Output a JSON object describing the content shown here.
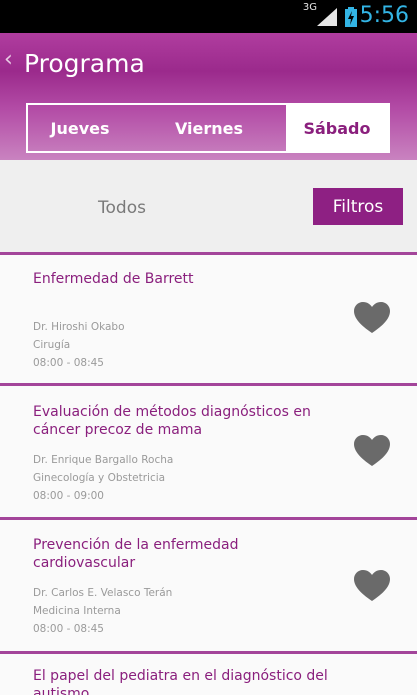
{
  "status_bar": {
    "network": "3G",
    "time": "5:56"
  },
  "header": {
    "title": "Programa",
    "back_icon": "chevron-left-icon"
  },
  "tabs": [
    {
      "label": "Jueves",
      "selected": false
    },
    {
      "label": "Viernes",
      "selected": false
    },
    {
      "label": "Sábado",
      "selected": true
    }
  ],
  "filters": {
    "all_label": "Todos",
    "filter_button": "Filtros"
  },
  "sessions": [
    {
      "title": "Enfermedad de Barrett",
      "speaker": "Dr. Hiroshi Okabo",
      "specialty": "Cirugía",
      "time": "08:00 - 08:45"
    },
    {
      "title": "Evaluación de métodos diagnósticos en cáncer precoz de mama",
      "speaker": "Dr. Enrique Bargallo Rocha",
      "specialty": "Ginecología y Obstetricia",
      "time": "08:00 - 09:00"
    },
    {
      "title": "Prevención de la enfermedad cardiovascular",
      "speaker": "Dr. Carlos E. Velasco Terán",
      "specialty": "Medicina Interna",
      "time": "08:00 - 08:45"
    },
    {
      "title": "El papel del pediatra en el diagnóstico del autismo",
      "speaker": "",
      "specialty": "",
      "time": ""
    }
  ],
  "colors": {
    "primary": "#8e2083",
    "accent": "#33b5e5",
    "heart": "#6a6a6a"
  }
}
